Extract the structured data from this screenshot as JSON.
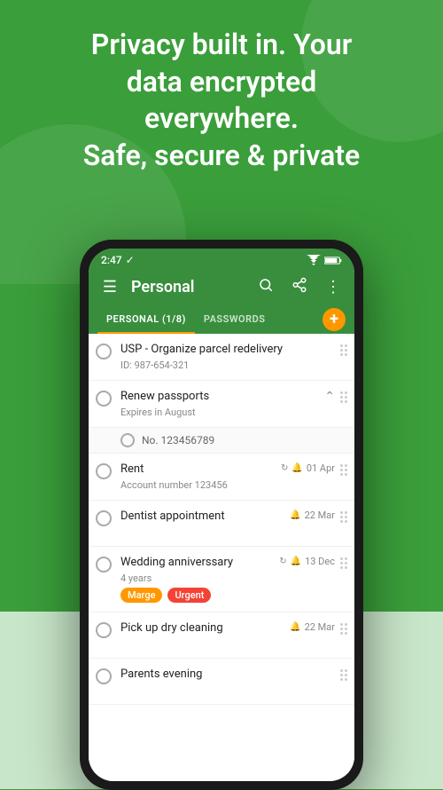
{
  "background": {
    "top_color": "#3a9e3a",
    "bottom_color": "#c8e6c9"
  },
  "headline": {
    "line1": "Privacy built in. Your",
    "line2": "data encrypted",
    "line3": "everywhere.",
    "line4": "Safe, secure & private"
  },
  "status_bar": {
    "time": "2:47",
    "check_icon": "✓"
  },
  "app_bar": {
    "menu_icon": "☰",
    "title": "Personal",
    "search_icon": "🔍",
    "share_icon": "◁",
    "more_icon": "⋮"
  },
  "tabs": [
    {
      "label": "PERSONAL (1/8)",
      "active": true
    },
    {
      "label": "PASSWORDS",
      "active": false
    }
  ],
  "add_button_label": "+",
  "list_items": [
    {
      "id": "item-1",
      "title": "USP - Organize parcel redelivery",
      "subtitle": "ID: 987-654-321",
      "has_checkbox": true,
      "has_repeat": false,
      "has_bell": false,
      "date": "",
      "has_chevron": false,
      "tags": [],
      "expanded": false
    },
    {
      "id": "item-2",
      "title": "Renew passports",
      "subtitle": "Expires in August",
      "has_checkbox": true,
      "has_repeat": false,
      "has_bell": false,
      "date": "",
      "has_chevron": true,
      "expanded": true,
      "sub_items": [
        {
          "label": "No. 123456789"
        }
      ],
      "tags": []
    },
    {
      "id": "item-3",
      "title": "Rent",
      "subtitle": "Account number 123456",
      "has_checkbox": true,
      "has_repeat": true,
      "has_bell": true,
      "date": "01 Apr",
      "has_chevron": false,
      "tags": [],
      "expanded": false
    },
    {
      "id": "item-4",
      "title": "Dentist appointment",
      "subtitle": "",
      "has_checkbox": true,
      "has_repeat": false,
      "has_bell": true,
      "date": "22 Mar",
      "has_chevron": false,
      "tags": [],
      "expanded": false
    },
    {
      "id": "item-5",
      "title": "Wedding anniverssary",
      "subtitle": "4 years",
      "has_checkbox": true,
      "has_repeat": true,
      "has_bell": true,
      "date": "13 Dec",
      "has_chevron": false,
      "tags": [
        "Marge",
        "Urgent"
      ],
      "expanded": false
    },
    {
      "id": "item-6",
      "title": "Pick up dry cleaning",
      "subtitle": "",
      "has_checkbox": true,
      "has_repeat": false,
      "has_bell": true,
      "date": "22 Mar",
      "has_chevron": false,
      "tags": [],
      "expanded": false
    },
    {
      "id": "item-7",
      "title": "Parents evening",
      "subtitle": "",
      "has_checkbox": true,
      "has_repeat": false,
      "has_bell": false,
      "date": "",
      "has_chevron": false,
      "tags": [],
      "expanded": false
    }
  ]
}
